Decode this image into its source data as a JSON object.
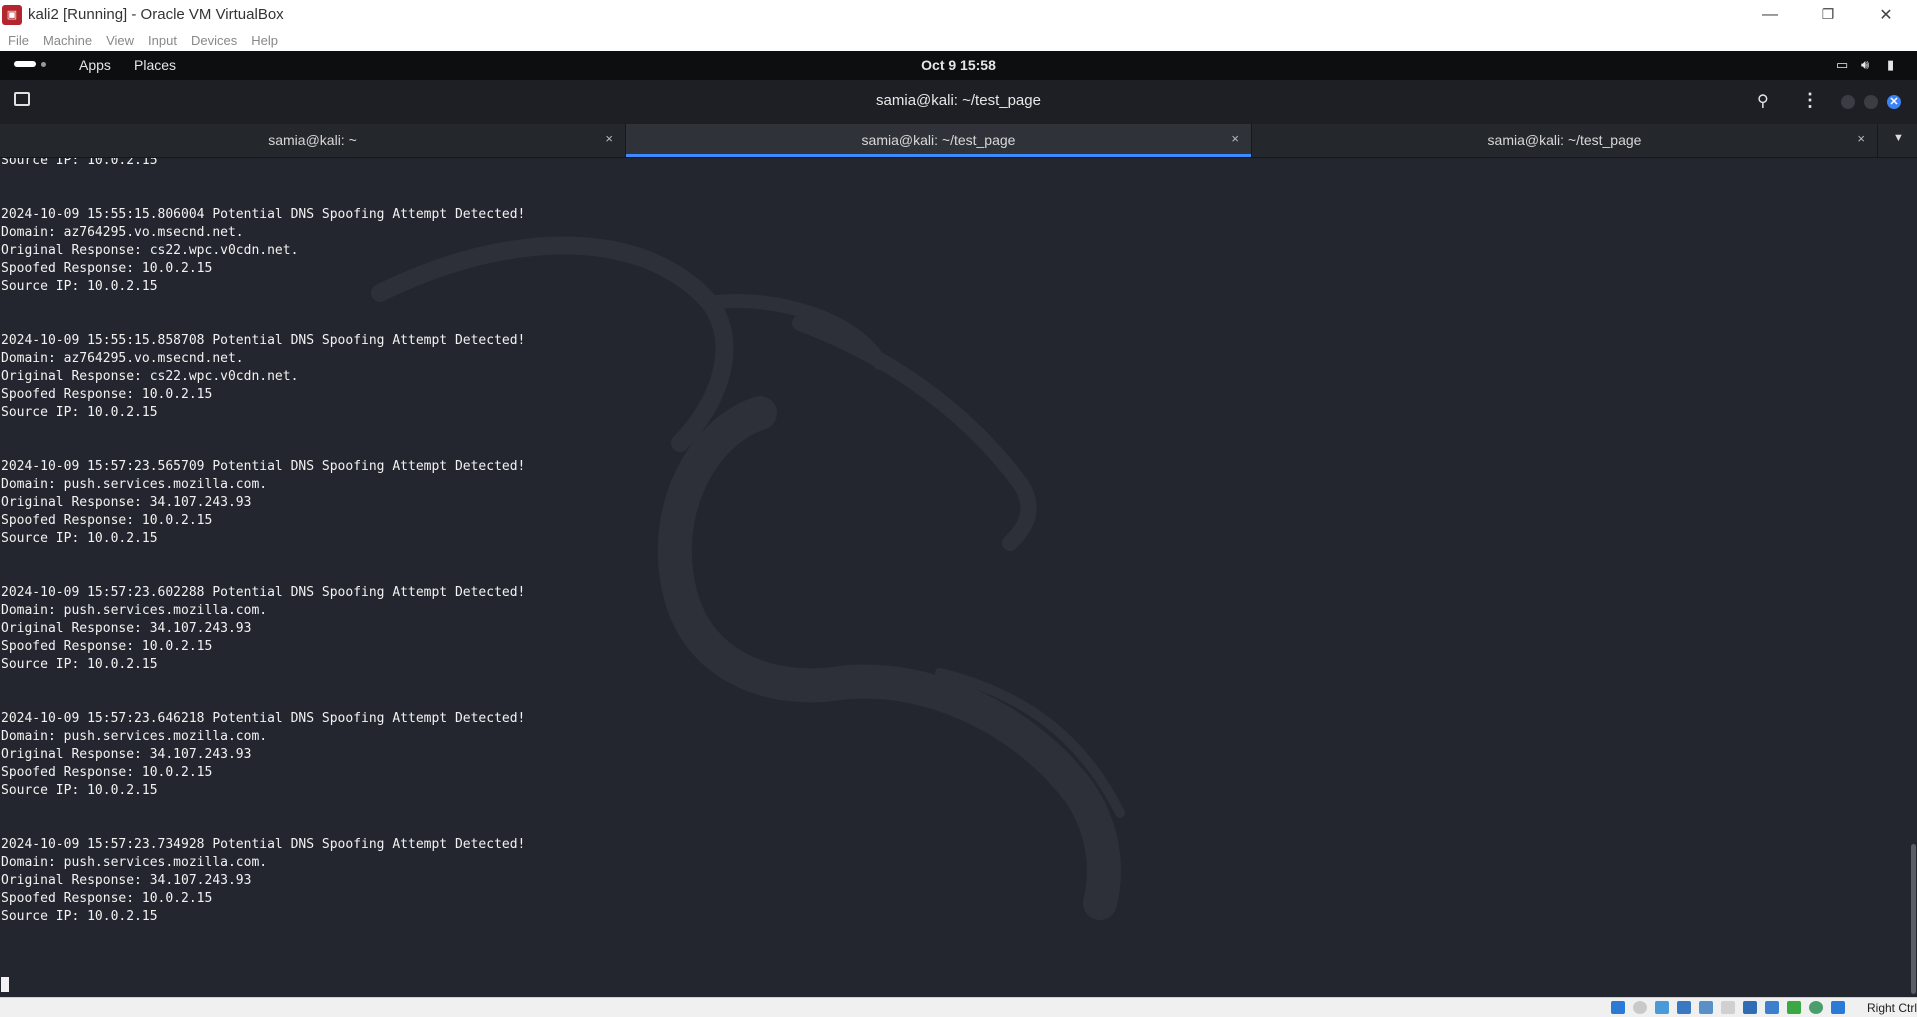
{
  "window": {
    "title": "kali2 [Running] - Oracle VM VirtualBox",
    "icon": "virtualbox-icon",
    "minimize": "—",
    "restore": "❐",
    "close": "✕"
  },
  "vbox_menu": [
    "File",
    "Machine",
    "View",
    "Input",
    "Devices",
    "Help"
  ],
  "gnome_panel": {
    "apps": "Apps",
    "places": "Places",
    "clock": "Oct 9  15:58"
  },
  "terminal": {
    "title": "samia@kali: ~/test_page",
    "tabs": [
      {
        "label": "samia@kali: ~",
        "active": false
      },
      {
        "label": "samia@kali: ~/test_page",
        "active": true
      },
      {
        "label": "samia@kali: ~/test_page",
        "active": false
      }
    ],
    "tab_close": "×",
    "lines": "Source IP: 10.0.2.15\n\n\n2024-10-09 15:55:15.806004 Potential DNS Spoofing Attempt Detected!\nDomain: az764295.vo.msecnd.net.\nOriginal Response: cs22.wpc.v0cdn.net.\nSpoofed Response: 10.0.2.15\nSource IP: 10.0.2.15\n\n\n2024-10-09 15:55:15.858708 Potential DNS Spoofing Attempt Detected!\nDomain: az764295.vo.msecnd.net.\nOriginal Response: cs22.wpc.v0cdn.net.\nSpoofed Response: 10.0.2.15\nSource IP: 10.0.2.15\n\n\n2024-10-09 15:57:23.565709 Potential DNS Spoofing Attempt Detected!\nDomain: push.services.mozilla.com.\nOriginal Response: 34.107.243.93\nSpoofed Response: 10.0.2.15\nSource IP: 10.0.2.15\n\n\n2024-10-09 15:57:23.602288 Potential DNS Spoofing Attempt Detected!\nDomain: push.services.mozilla.com.\nOriginal Response: 34.107.243.93\nSpoofed Response: 10.0.2.15\nSource IP: 10.0.2.15\n\n\n2024-10-09 15:57:23.646218 Potential DNS Spoofing Attempt Detected!\nDomain: push.services.mozilla.com.\nOriginal Response: 34.107.243.93\nSpoofed Response: 10.0.2.15\nSource IP: 10.0.2.15\n\n\n2024-10-09 15:57:23.734928 Potential DNS Spoofing Attempt Detected!\nDomain: push.services.mozilla.com.\nOriginal Response: 34.107.243.93\nSpoofed Response: 10.0.2.15\nSource IP: 10.0.2.15"
  },
  "statusbar": {
    "host_key": "Right Ctrl"
  },
  "colors": {
    "terminal_bg": "#23262e",
    "accent": "#3d8bfd",
    "text": "#f2f2f2"
  }
}
